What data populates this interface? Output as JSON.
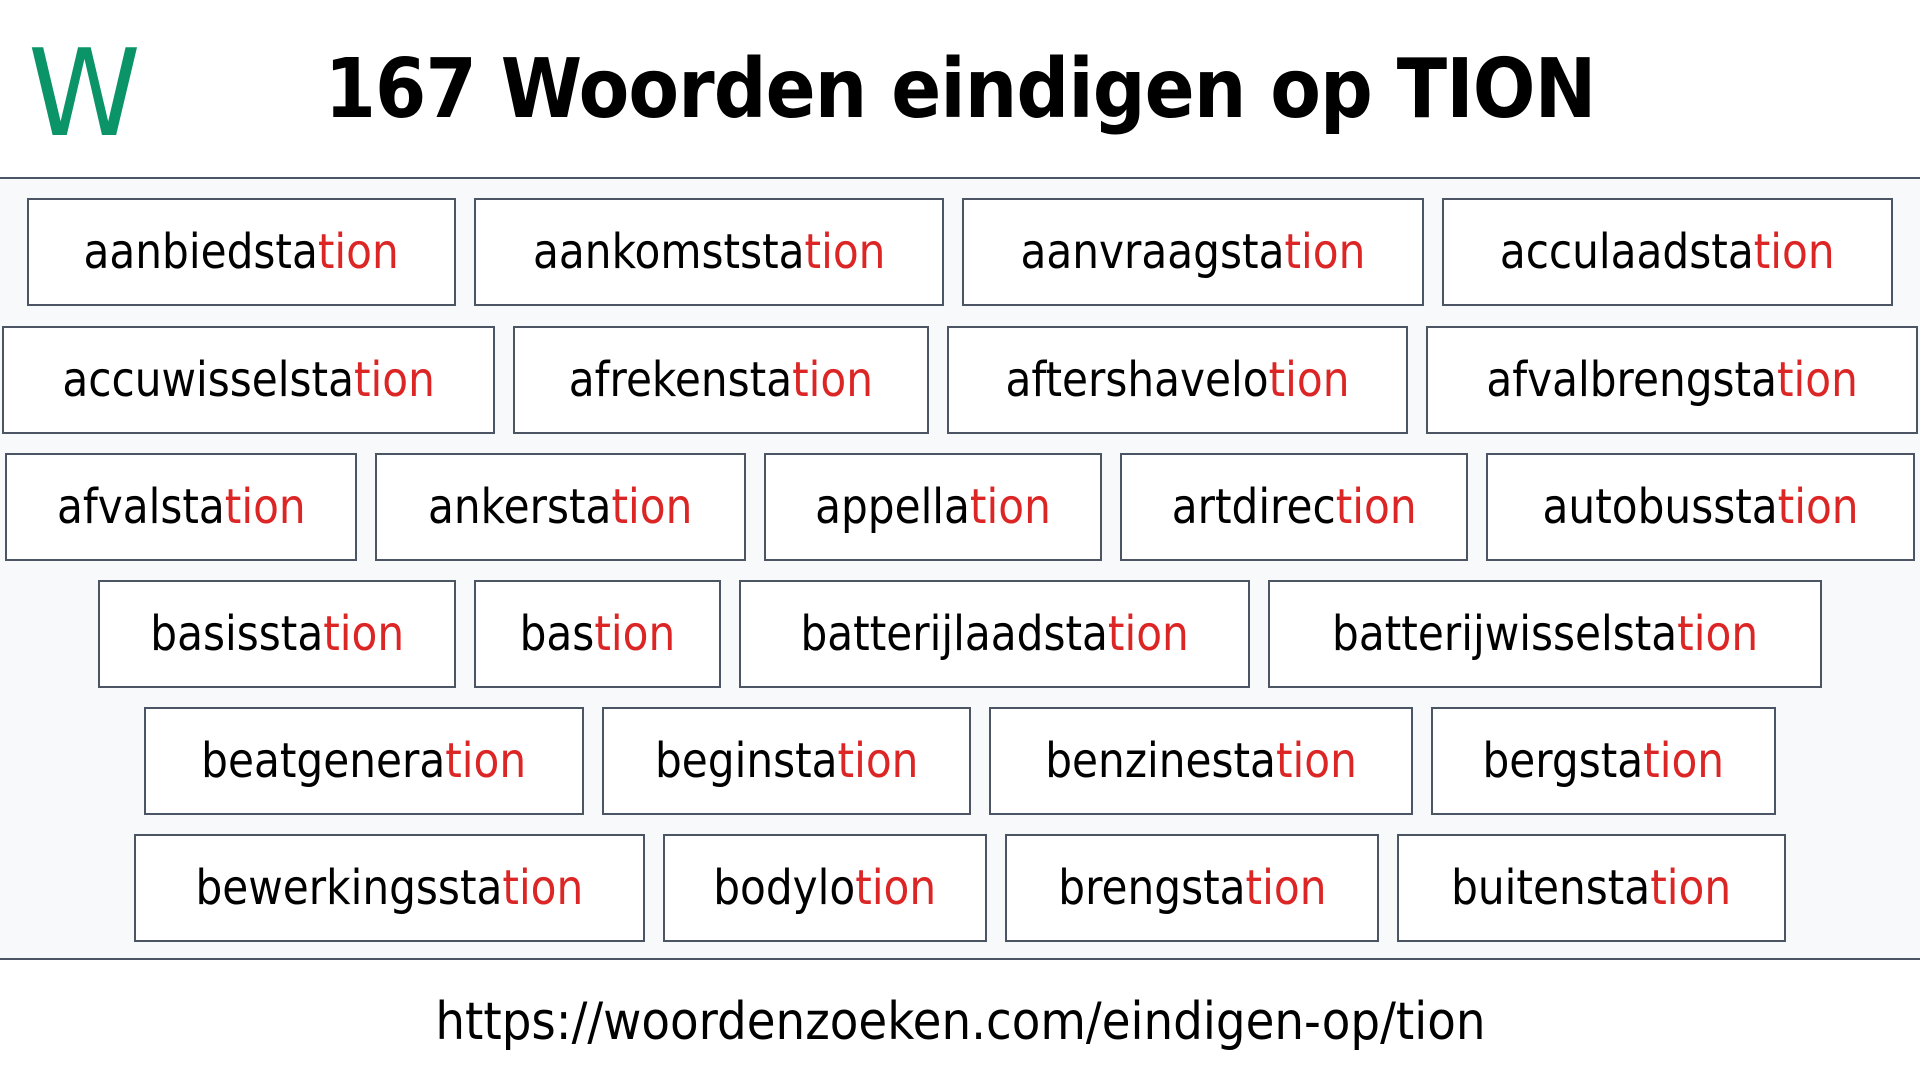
{
  "header": {
    "logo_letter": "W",
    "title": "167 Woorden eindigen op TION"
  },
  "colors": {
    "brand_green": "#0b9467",
    "suffix_red": "#dc2626",
    "border": "#4b5563",
    "background": "#f8f9fb"
  },
  "suffix": "tion",
  "rows": [
    [
      {
        "stem": "aanbiedsta",
        "suffix": "tion"
      },
      {
        "stem": "aankomststa",
        "suffix": "tion"
      },
      {
        "stem": "aanvraagsta",
        "suffix": "tion"
      },
      {
        "stem": "acculaadsta",
        "suffix": "tion"
      }
    ],
    [
      {
        "stem": "accuwisselsta",
        "suffix": "tion"
      },
      {
        "stem": "afrekensta",
        "suffix": "tion"
      },
      {
        "stem": "aftershavelo",
        "suffix": "tion"
      },
      {
        "stem": "afvalbrengsta",
        "suffix": "tion"
      }
    ],
    [
      {
        "stem": "afvalsta",
        "suffix": "tion"
      },
      {
        "stem": "ankersta",
        "suffix": "tion"
      },
      {
        "stem": "appella",
        "suffix": "tion"
      },
      {
        "stem": "artdirec",
        "suffix": "tion"
      },
      {
        "stem": "autobussta",
        "suffix": "tion"
      }
    ],
    [
      {
        "stem": "basissta",
        "suffix": "tion"
      },
      {
        "stem": "bas",
        "suffix": "tion"
      },
      {
        "stem": "batterijlaadsta",
        "suffix": "tion"
      },
      {
        "stem": "batterijwisselsta",
        "suffix": "tion"
      }
    ],
    [
      {
        "stem": "beatgenera",
        "suffix": "tion"
      },
      {
        "stem": "beginsta",
        "suffix": "tion"
      },
      {
        "stem": "benzinesta",
        "suffix": "tion"
      },
      {
        "stem": "bergsta",
        "suffix": "tion"
      }
    ],
    [
      {
        "stem": "bewerkingssta",
        "suffix": "tion"
      },
      {
        "stem": "bodylo",
        "suffix": "tion"
      },
      {
        "stem": "brengsta",
        "suffix": "tion"
      },
      {
        "stem": "buitensta",
        "suffix": "tion"
      }
    ]
  ],
  "footer": {
    "url": "https://woordenzoeken.com/eindigen-op/tion"
  }
}
